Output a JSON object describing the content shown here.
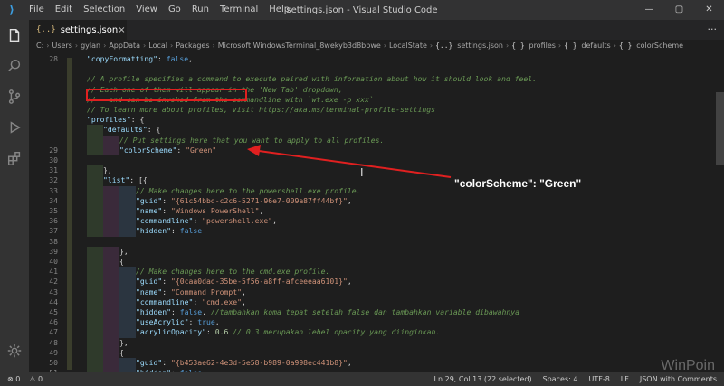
{
  "window": {
    "title": "settings.json - Visual Studio Code",
    "menu": [
      "File",
      "Edit",
      "Selection",
      "View",
      "Go",
      "Run",
      "Terminal",
      "Help"
    ],
    "controls": [
      "—",
      "▢",
      "✕"
    ]
  },
  "tab": {
    "icon": "{..}",
    "label": "settings.json",
    "close": "×",
    "more": "···"
  },
  "breadcrumb": {
    "path": [
      "C:",
      "Users",
      "gylan",
      "AppData",
      "Local",
      "Packages",
      "Microsoft.WindowsTerminal_8wekyb3d8bbwe",
      "LocalState"
    ],
    "file": "settings.json",
    "symbols": [
      "profiles",
      "defaults",
      "colorScheme"
    ]
  },
  "code_lines": [
    {
      "n": "28",
      "parts": [
        [
          "k",
          "\"copyFormatting\""
        ],
        [
          "p",
          ": "
        ],
        [
          "b",
          "false"
        ],
        [
          "p",
          ","
        ]
      ],
      "indent": 1
    },
    {
      "n": "",
      "parts": [],
      "indent": 0
    },
    {
      "n": "",
      "parts": [
        [
          "c",
          "// A profile specifies a command to execute paired with information about how it should look and feel."
        ]
      ],
      "indent": 1
    },
    {
      "n": "",
      "parts": [
        [
          "c",
          "// Each one of them will appear in the 'New Tab' dropdown,"
        ]
      ],
      "indent": 1
    },
    {
      "n": "",
      "parts": [
        [
          "c",
          "//   and can be invoked from the commandline with `wt.exe -p xxx`"
        ]
      ],
      "indent": 1
    },
    {
      "n": "",
      "parts": [
        [
          "c",
          "// To learn more about profiles, visit https://aka.ms/terminal-profile-settings"
        ]
      ],
      "indent": 1
    },
    {
      "n": "",
      "parts": [
        [
          "k",
          "\"profiles\""
        ],
        [
          "p",
          ": {"
        ]
      ],
      "indent": 1
    },
    {
      "n": "",
      "parts": [
        [
          "k",
          "\"defaults\""
        ],
        [
          "p",
          ": {"
        ]
      ],
      "indent": 2
    },
    {
      "n": "",
      "parts": [
        [
          "c",
          "// Put settings here that you want to apply to all profiles."
        ]
      ],
      "indent": 3
    },
    {
      "n": "29",
      "parts": [
        [
          "k",
          "\"colorScheme\""
        ],
        [
          "p",
          ": "
        ],
        [
          "s",
          "\"Green\""
        ]
      ],
      "indent": 3
    },
    {
      "n": "30",
      "parts": [],
      "indent": 0
    },
    {
      "n": "31",
      "parts": [
        [
          "p",
          "},"
        ]
      ],
      "indent": 2
    },
    {
      "n": "32",
      "parts": [
        [
          "k",
          "\"list\""
        ],
        [
          "p",
          ": [{"
        ]
      ],
      "indent": 2
    },
    {
      "n": "33",
      "parts": [
        [
          "c",
          "// Make changes here to the powershell.exe profile."
        ]
      ],
      "indent": 4
    },
    {
      "n": "34",
      "parts": [
        [
          "k",
          "\"guid\""
        ],
        [
          "p",
          ": "
        ],
        [
          "s",
          "\"{61c54bbd-c2c6-5271-96e7-009a87ff44bf}\""
        ],
        [
          "p",
          ","
        ]
      ],
      "indent": 4
    },
    {
      "n": "35",
      "parts": [
        [
          "k",
          "\"name\""
        ],
        [
          "p",
          ": "
        ],
        [
          "s",
          "\"Windows PowerShell\""
        ],
        [
          "p",
          ","
        ]
      ],
      "indent": 4
    },
    {
      "n": "36",
      "parts": [
        [
          "k",
          "\"commandline\""
        ],
        [
          "p",
          ": "
        ],
        [
          "s",
          "\"powershell.exe\""
        ],
        [
          "p",
          ","
        ]
      ],
      "indent": 4
    },
    {
      "n": "37",
      "parts": [
        [
          "k",
          "\"hidden\""
        ],
        [
          "p",
          ": "
        ],
        [
          "b",
          "false"
        ]
      ],
      "indent": 4
    },
    {
      "n": "38",
      "parts": [],
      "indent": 0
    },
    {
      "n": "39",
      "parts": [
        [
          "p",
          "},"
        ]
      ],
      "indent": 3
    },
    {
      "n": "40",
      "parts": [
        [
          "p",
          "{"
        ]
      ],
      "indent": 3
    },
    {
      "n": "41",
      "parts": [
        [
          "c",
          "// Make changes here to the cmd.exe profile."
        ]
      ],
      "indent": 4
    },
    {
      "n": "42",
      "parts": [
        [
          "k",
          "\"guid\""
        ],
        [
          "p",
          ": "
        ],
        [
          "s",
          "\"{0caa0dad-35be-5f56-a8ff-afceeeaa6101}\""
        ],
        [
          "p",
          ","
        ]
      ],
      "indent": 4
    },
    {
      "n": "43",
      "parts": [
        [
          "k",
          "\"name\""
        ],
        [
          "p",
          ": "
        ],
        [
          "s",
          "\"Command Prompt\""
        ],
        [
          "p",
          ","
        ]
      ],
      "indent": 4
    },
    {
      "n": "44",
      "parts": [
        [
          "k",
          "\"commandline\""
        ],
        [
          "p",
          ": "
        ],
        [
          "s",
          "\"cmd.exe\""
        ],
        [
          "p",
          ","
        ]
      ],
      "indent": 4
    },
    {
      "n": "45",
      "parts": [
        [
          "k",
          "\"hidden\""
        ],
        [
          "p",
          ": "
        ],
        [
          "b",
          "false"
        ],
        [
          "p",
          ", "
        ],
        [
          "c",
          "//tambahkan koma tepat setelah false dan tambahkan variable dibawahnya"
        ]
      ],
      "indent": 4
    },
    {
      "n": "46",
      "parts": [
        [
          "k",
          "\"useAcrylic\""
        ],
        [
          "p",
          ": "
        ],
        [
          "b",
          "true"
        ],
        [
          "p",
          ","
        ]
      ],
      "indent": 4
    },
    {
      "n": "47",
      "parts": [
        [
          "k",
          "\"acrylicOpacity\""
        ],
        [
          "p",
          ": "
        ],
        [
          "n",
          "0.6"
        ],
        [
          "p",
          " "
        ],
        [
          "c",
          "// 0.3 merupakan lebel opacity yang diinginkan."
        ]
      ],
      "indent": 4
    },
    {
      "n": "48",
      "parts": [
        [
          "p",
          "},"
        ]
      ],
      "indent": 3
    },
    {
      "n": "49",
      "parts": [
        [
          "p",
          "{"
        ]
      ],
      "indent": 3
    },
    {
      "n": "50",
      "parts": [
        [
          "k",
          "\"guid\""
        ],
        [
          "p",
          ": "
        ],
        [
          "s",
          "\"{b453ae62-4e3d-5e58-b989-0a998ec441b8}\""
        ],
        [
          "p",
          ","
        ]
      ],
      "indent": 4
    },
    {
      "n": "51",
      "parts": [
        [
          "k",
          "\"hidden\""
        ],
        [
          "p",
          ": "
        ],
        [
          "b",
          "false"
        ],
        [
          "p",
          ","
        ]
      ],
      "indent": 4
    }
  ],
  "annotation": {
    "text": "\"colorScheme\": \"Green\""
  },
  "status": {
    "errors": "⊗ 0",
    "warnings": "⚠ 0",
    "position": "Ln 29, Col 13 (22 selected)",
    "spaces": "Spaces: 4",
    "encoding": "UTF-8",
    "eol": "LF",
    "language": "JSON with Comments"
  },
  "watermark": "WinPoin",
  "colors": {
    "accent": "#007acc",
    "highlight": "#e02020"
  }
}
